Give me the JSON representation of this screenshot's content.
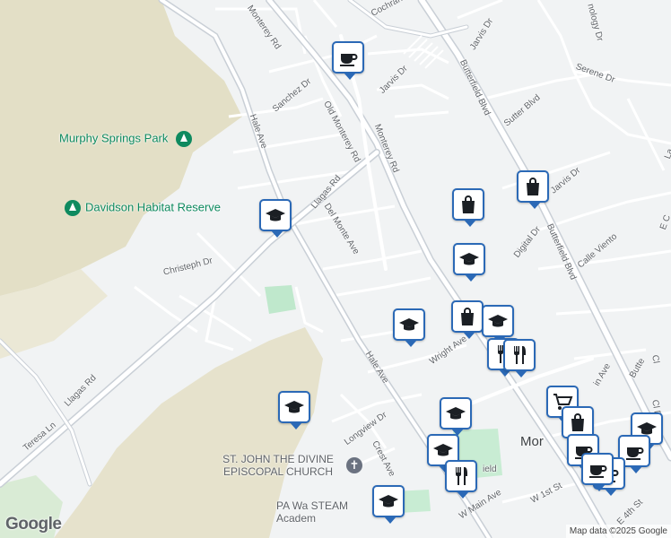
{
  "map": {
    "colors": {
      "background": "#f1f3f4",
      "hills": "#e3dfc6",
      "park": "#bfe8cc",
      "road": "#ffffff",
      "major_road": "#c9cfd6",
      "pin_border": "#2b69b6",
      "poi_green": "#0e8a5f"
    },
    "roads": [
      "Monterey Rd",
      "Cochrane Rd",
      "Jarvis Dr",
      "Sanchez Dr",
      "Old Monterey Rd",
      "Hale Ave",
      "Monterey Rd",
      "Butterfield Blvd",
      "Sutter Blvd",
      "Serene Dr",
      "Llagas Rd",
      "Del Monte Ave",
      "Jarvis Dr",
      "Digital Dr",
      "Butterfield Blvd",
      "Calle Viento",
      "Christeph Dr",
      "Wright Ave",
      "Hale Ave",
      "Llagas Rd",
      "Teresa Ln",
      "Longview Dr",
      "Crest Ave",
      "W Main Ave",
      "W 1st St",
      "E 4th St",
      "Jarvis Dr",
      "nology Dr",
      "La",
      "E C",
      "Cl",
      "Cl De",
      "in Ave",
      "Butte",
      "ield",
      "Mor"
    ],
    "places": {
      "murphy_park": "Murphy Springs Park",
      "davidson": "Davidson Habitat Reserve",
      "church": "ST. JOHN THE DIVINE EPISCOPAL CHURCH",
      "school": "PA Wa STEAM Academ"
    },
    "pins": [
      "coffee-icon",
      "graduation-cap-icon",
      "shopping-bag-icon",
      "shopping-bag-icon",
      "graduation-cap-icon",
      "graduation-cap-icon",
      "shopping-bag-icon",
      "graduation-cap-icon",
      "fork-knife-icon",
      "fork-knife-icon",
      "graduation-cap-icon",
      "cart-icon",
      "graduation-cap-icon",
      "shopping-bag-icon",
      "graduation-cap-icon",
      "coffee-icon",
      "graduation-cap-icon",
      "coffee-icon",
      "fork-knife-icon",
      "graduation-cap-icon",
      "coffee-icon",
      "coffee-icon"
    ]
  },
  "footer": {
    "google_logo": "Google",
    "attribution": "Map data ©2025 Google"
  }
}
